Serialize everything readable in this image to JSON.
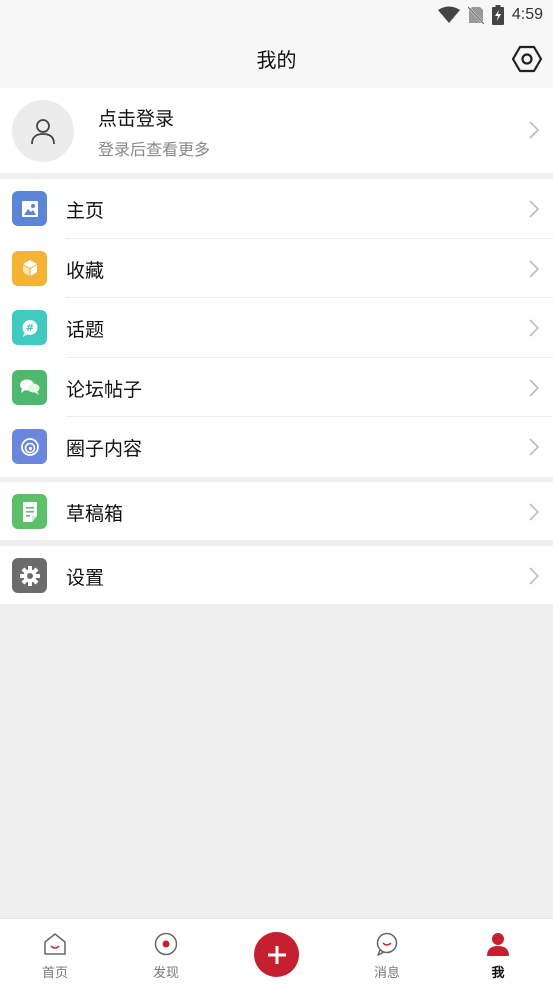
{
  "status_bar": {
    "time": "4:59"
  },
  "header": {
    "title": "我的"
  },
  "login": {
    "title": "点击登录",
    "subtitle": "登录后查看更多"
  },
  "menu_groups": [
    [
      {
        "label": "主页",
        "icon": "image-icon",
        "color": "#5b86d8"
      },
      {
        "label": "收藏",
        "icon": "box-icon",
        "color": "#f5b335"
      },
      {
        "label": "话题",
        "icon": "hashtag-bubble-icon",
        "color": "#3fcac0"
      },
      {
        "label": "论坛帖子",
        "icon": "chat-bubbles-icon",
        "color": "#4fb86f"
      },
      {
        "label": "圈子内容",
        "icon": "swirl-icon",
        "color": "#6b87dd"
      }
    ],
    [
      {
        "label": "草稿箱",
        "icon": "draft-icon",
        "color": "#5cbf6a"
      }
    ],
    [
      {
        "label": "设置",
        "icon": "gear-icon",
        "color": "#6b6b6b"
      }
    ]
  ],
  "tabbar": {
    "items": [
      {
        "label": "首页",
        "icon": "home-icon"
      },
      {
        "label": "发现",
        "icon": "discover-icon"
      },
      {
        "label": "消息",
        "icon": "message-icon"
      },
      {
        "label": "我",
        "icon": "profile-icon",
        "active": true
      }
    ],
    "accent": "#c5202f"
  }
}
